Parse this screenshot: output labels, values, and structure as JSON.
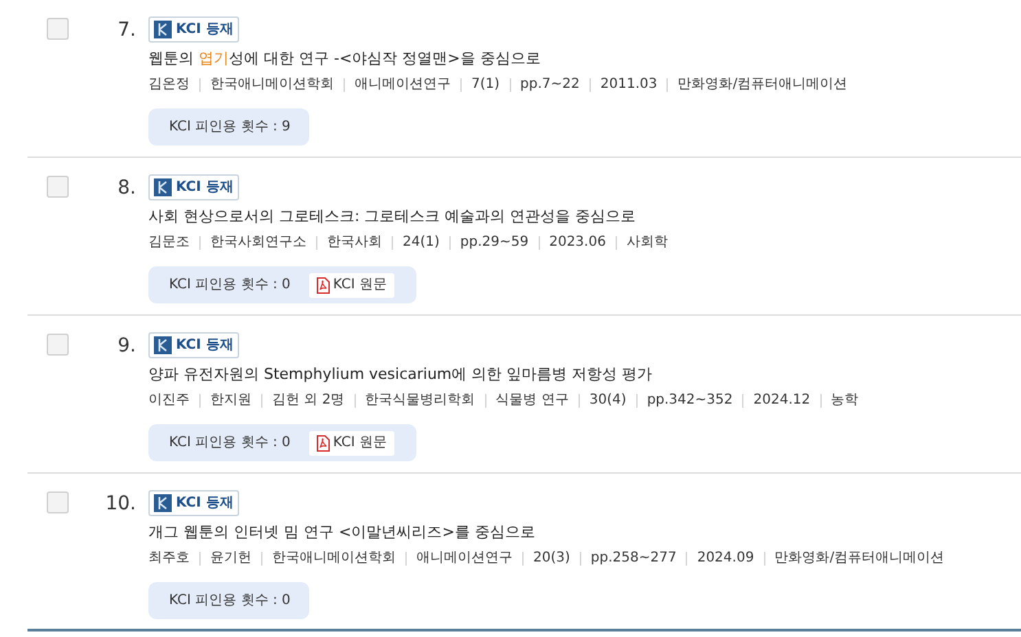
{
  "results": [
    {
      "number": "7.",
      "checked": false,
      "badge": "KCI 등재",
      "title": [
        {
          "text": "웹툰의 ",
          "highlight": false
        },
        {
          "text": "엽기",
          "highlight": true
        },
        {
          "text": "성에 대한 연구 -<야심작 정열맨>을 중심으로",
          "highlight": false
        }
      ],
      "meta": [
        "김온정",
        "한국애니메이션학회",
        "애니메이션연구",
        "7(1)",
        "pp.7~22",
        "2011.03",
        "만화영화/컴퓨터애니메이션"
      ],
      "citations": "KCI 피인용 횟수 : 9"
    },
    {
      "number": "8.",
      "checked": false,
      "badge": "KCI 등재",
      "title": [
        {
          "text": "사회 현상으로서의 그로테스크: 그로테스크 예술과의 연관성을 중심으로",
          "highlight": false
        }
      ],
      "meta": [
        "김문조",
        "한국사회연구소",
        "한국사회",
        "24(1)",
        "pp.29~59",
        "2023.06",
        "사회학"
      ],
      "citations": "KCI 피인용 횟수 : 0",
      "pdf_link": "KCI 원문"
    },
    {
      "number": "9.",
      "checked": false,
      "badge": "KCI 등재",
      "title": [
        {
          "text": "양파 유전자원의 Stemphylium vesicarium에 의한 잎마름병 저항성 평가",
          "highlight": false
        }
      ],
      "meta": [
        "이진주",
        "한지원",
        "김헌 외 2명",
        "한국식물병리학회",
        "식물병 연구",
        "30(4)",
        "pp.342~352",
        "2024.12",
        "농학"
      ],
      "citations": "KCI 피인용 횟수 : 0",
      "pdf_link": "KCI 원문"
    },
    {
      "number": "10.",
      "checked": false,
      "badge": "KCI 등재",
      "title": [
        {
          "text": "개그 웹툰의 인터넷 밈 연구 <이말년씨리즈>를 중심으로",
          "highlight": false
        }
      ],
      "meta": [
        "최주호",
        "윤기헌",
        "한국애니메이션학회",
        "애니메이션연구",
        "20(3)",
        "pp.258~277",
        "2024.09",
        "만화영화/컴퓨터애니메이션"
      ],
      "citations": "KCI 피인용 횟수 : 0"
    }
  ]
}
